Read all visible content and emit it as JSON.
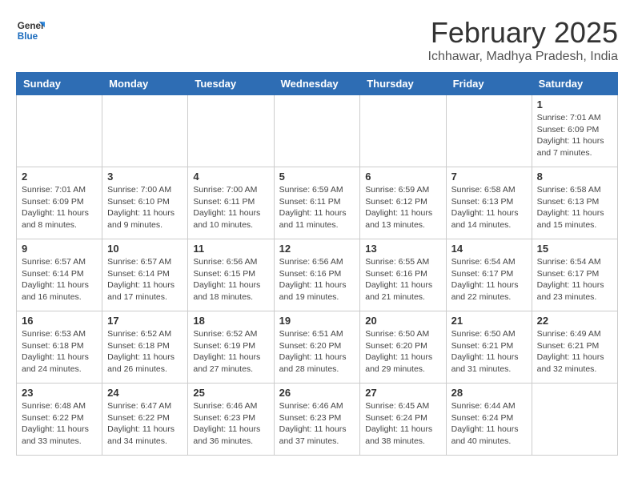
{
  "header": {
    "logo_line1": "General",
    "logo_line2": "Blue",
    "month_year": "February 2025",
    "location": "Ichhawar, Madhya Pradesh, India"
  },
  "weekdays": [
    "Sunday",
    "Monday",
    "Tuesday",
    "Wednesday",
    "Thursday",
    "Friday",
    "Saturday"
  ],
  "weeks": [
    [
      {
        "day": "",
        "info": ""
      },
      {
        "day": "",
        "info": ""
      },
      {
        "day": "",
        "info": ""
      },
      {
        "day": "",
        "info": ""
      },
      {
        "day": "",
        "info": ""
      },
      {
        "day": "",
        "info": ""
      },
      {
        "day": "1",
        "info": "Sunrise: 7:01 AM\nSunset: 6:09 PM\nDaylight: 11 hours\nand 7 minutes."
      }
    ],
    [
      {
        "day": "2",
        "info": "Sunrise: 7:01 AM\nSunset: 6:09 PM\nDaylight: 11 hours\nand 8 minutes."
      },
      {
        "day": "3",
        "info": "Sunrise: 7:00 AM\nSunset: 6:10 PM\nDaylight: 11 hours\nand 9 minutes."
      },
      {
        "day": "4",
        "info": "Sunrise: 7:00 AM\nSunset: 6:11 PM\nDaylight: 11 hours\nand 10 minutes."
      },
      {
        "day": "5",
        "info": "Sunrise: 6:59 AM\nSunset: 6:11 PM\nDaylight: 11 hours\nand 11 minutes."
      },
      {
        "day": "6",
        "info": "Sunrise: 6:59 AM\nSunset: 6:12 PM\nDaylight: 11 hours\nand 13 minutes."
      },
      {
        "day": "7",
        "info": "Sunrise: 6:58 AM\nSunset: 6:13 PM\nDaylight: 11 hours\nand 14 minutes."
      },
      {
        "day": "8",
        "info": "Sunrise: 6:58 AM\nSunset: 6:13 PM\nDaylight: 11 hours\nand 15 minutes."
      }
    ],
    [
      {
        "day": "9",
        "info": "Sunrise: 6:57 AM\nSunset: 6:14 PM\nDaylight: 11 hours\nand 16 minutes."
      },
      {
        "day": "10",
        "info": "Sunrise: 6:57 AM\nSunset: 6:14 PM\nDaylight: 11 hours\nand 17 minutes."
      },
      {
        "day": "11",
        "info": "Sunrise: 6:56 AM\nSunset: 6:15 PM\nDaylight: 11 hours\nand 18 minutes."
      },
      {
        "day": "12",
        "info": "Sunrise: 6:56 AM\nSunset: 6:16 PM\nDaylight: 11 hours\nand 19 minutes."
      },
      {
        "day": "13",
        "info": "Sunrise: 6:55 AM\nSunset: 6:16 PM\nDaylight: 11 hours\nand 21 minutes."
      },
      {
        "day": "14",
        "info": "Sunrise: 6:54 AM\nSunset: 6:17 PM\nDaylight: 11 hours\nand 22 minutes."
      },
      {
        "day": "15",
        "info": "Sunrise: 6:54 AM\nSunset: 6:17 PM\nDaylight: 11 hours\nand 23 minutes."
      }
    ],
    [
      {
        "day": "16",
        "info": "Sunrise: 6:53 AM\nSunset: 6:18 PM\nDaylight: 11 hours\nand 24 minutes."
      },
      {
        "day": "17",
        "info": "Sunrise: 6:52 AM\nSunset: 6:18 PM\nDaylight: 11 hours\nand 26 minutes."
      },
      {
        "day": "18",
        "info": "Sunrise: 6:52 AM\nSunset: 6:19 PM\nDaylight: 11 hours\nand 27 minutes."
      },
      {
        "day": "19",
        "info": "Sunrise: 6:51 AM\nSunset: 6:20 PM\nDaylight: 11 hours\nand 28 minutes."
      },
      {
        "day": "20",
        "info": "Sunrise: 6:50 AM\nSunset: 6:20 PM\nDaylight: 11 hours\nand 29 minutes."
      },
      {
        "day": "21",
        "info": "Sunrise: 6:50 AM\nSunset: 6:21 PM\nDaylight: 11 hours\nand 31 minutes."
      },
      {
        "day": "22",
        "info": "Sunrise: 6:49 AM\nSunset: 6:21 PM\nDaylight: 11 hours\nand 32 minutes."
      }
    ],
    [
      {
        "day": "23",
        "info": "Sunrise: 6:48 AM\nSunset: 6:22 PM\nDaylight: 11 hours\nand 33 minutes."
      },
      {
        "day": "24",
        "info": "Sunrise: 6:47 AM\nSunset: 6:22 PM\nDaylight: 11 hours\nand 34 minutes."
      },
      {
        "day": "25",
        "info": "Sunrise: 6:46 AM\nSunset: 6:23 PM\nDaylight: 11 hours\nand 36 minutes."
      },
      {
        "day": "26",
        "info": "Sunrise: 6:46 AM\nSunset: 6:23 PM\nDaylight: 11 hours\nand 37 minutes."
      },
      {
        "day": "27",
        "info": "Sunrise: 6:45 AM\nSunset: 6:24 PM\nDaylight: 11 hours\nand 38 minutes."
      },
      {
        "day": "28",
        "info": "Sunrise: 6:44 AM\nSunset: 6:24 PM\nDaylight: 11 hours\nand 40 minutes."
      },
      {
        "day": "",
        "info": ""
      }
    ]
  ]
}
